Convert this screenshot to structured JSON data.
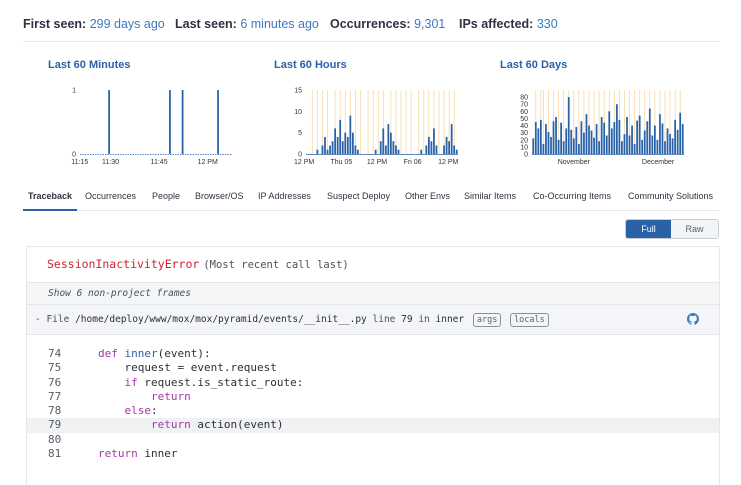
{
  "stats": {
    "first_seen_label": "First seen:",
    "first_seen_value": "299 days ago",
    "last_seen_label": "Last seen:",
    "last_seen_value": "6 minutes ago",
    "occurrences_label": "Occurrences:",
    "occurrences_value": "9,301",
    "ips_label": "IPs affected:",
    "ips_value": "330"
  },
  "colors": {
    "accent": "#2a62a8",
    "link": "#3a7bbf",
    "error": "#d0222c",
    "bar": "#2a62a8",
    "deploy_marker": "#f5d9a4"
  },
  "chart_data": [
    {
      "type": "bar",
      "title": "Last 60 Minutes",
      "yticks": [
        "1",
        "0"
      ],
      "ylim": [
        0,
        1
      ],
      "xticks": [
        "11:15",
        "11:30",
        "11:45",
        "12 PM"
      ],
      "values": [
        0,
        0,
        0,
        0,
        0,
        0,
        0,
        0,
        0,
        0,
        0,
        1,
        0,
        0,
        0,
        0,
        0,
        0,
        0,
        0,
        0,
        0,
        0,
        0,
        0,
        0,
        0,
        0,
        0,
        0,
        0,
        0,
        0,
        0,
        0,
        1,
        0,
        0,
        0,
        0,
        1,
        0,
        0,
        0,
        0,
        0,
        0,
        0,
        0,
        0,
        0,
        0,
        0,
        0,
        1,
        0,
        0,
        0,
        0,
        0
      ]
    },
    {
      "type": "bar",
      "title": "Last 60 Hours",
      "yticks": [
        "15",
        "10",
        "5",
        "0"
      ],
      "ylim": [
        0,
        15
      ],
      "xticks": [
        "12 PM",
        "Thu 05",
        "12 PM",
        "Fri 06",
        "12 PM"
      ],
      "values": [
        0,
        0,
        0,
        0,
        1,
        0,
        2,
        4,
        1,
        2,
        3,
        6,
        4,
        8,
        3,
        5,
        4,
        9,
        5,
        2,
        1,
        0,
        0,
        0,
        0,
        0,
        0,
        1,
        0,
        3,
        6,
        2,
        7,
        5,
        3,
        2,
        1,
        0,
        0,
        0,
        0,
        0,
        0,
        0,
        0,
        1,
        0,
        2,
        4,
        3,
        6,
        2,
        0,
        0,
        2,
        4,
        3,
        7,
        2,
        1
      ],
      "deploys": [
        2,
        4,
        6,
        8,
        11,
        13,
        15,
        17,
        19,
        21,
        24,
        26,
        28,
        30,
        33,
        35,
        37,
        39,
        41,
        44,
        46,
        48,
        50,
        52,
        54,
        56,
        58
      ]
    },
    {
      "type": "bar",
      "title": "Last 60 Days",
      "yticks": [
        "80",
        "70",
        "60",
        "50",
        "40",
        "30",
        "20",
        "10",
        "0"
      ],
      "ylim": [
        0,
        90
      ],
      "xticks": [
        "November",
        "December"
      ],
      "values": [
        22,
        45,
        36,
        48,
        14,
        42,
        31,
        24,
        46,
        52,
        20,
        44,
        18,
        36,
        80,
        34,
        22,
        38,
        14,
        46,
        30,
        56,
        40,
        33,
        23,
        42,
        18,
        52,
        44,
        26,
        60,
        36,
        45,
        70,
        48,
        18,
        28,
        52,
        26,
        40,
        14,
        47,
        54,
        20,
        33,
        46,
        64,
        26,
        40,
        20,
        56,
        43,
        18,
        36,
        28,
        22,
        48,
        34,
        58,
        42
      ],
      "deploys": [
        1,
        3,
        4,
        6,
        8,
        10,
        12,
        14,
        16,
        18,
        20,
        22,
        24,
        26,
        28,
        30,
        32,
        34,
        36,
        38,
        40,
        42,
        44,
        46,
        48,
        50,
        52,
        54,
        56,
        58
      ]
    }
  ],
  "tabs": [
    {
      "label": "Traceback"
    },
    {
      "label": "Occurrences"
    },
    {
      "label": "People"
    },
    {
      "label": "Browser/OS"
    },
    {
      "label": "IP Addresses"
    },
    {
      "label": "Suspect Deploy"
    },
    {
      "label": "Other Envs"
    },
    {
      "label": "Similar Items"
    },
    {
      "label": "Co-Occurring Items"
    },
    {
      "label": "Community Solutions"
    }
  ],
  "toggle": {
    "full": "Full",
    "raw": "Raw",
    "selected": "Full"
  },
  "trace": {
    "error_name": "SessionInactivityError",
    "error_tail": "(Most recent call last)",
    "frames_toggle": "Show 6 non-project frames",
    "file_prefix": "- File",
    "file_path": "/home/deploy/www/mox/mox/pyramid/events/__init__.py",
    "line_word": "line",
    "line_number": "79",
    "in_word": "in",
    "function": "inner",
    "args_label": "args",
    "locals_label": "locals",
    "github_icon": "github-icon"
  },
  "code": [
    {
      "n": "74",
      "indent": "",
      "parts": [
        {
          "t": "def",
          "c": "kw"
        },
        {
          "t": " "
        },
        {
          "t": "inner",
          "c": "fn"
        },
        {
          "t": "(event):"
        }
      ]
    },
    {
      "n": "75",
      "indent": "    ",
      "parts": [
        {
          "t": "request = event.request"
        }
      ]
    },
    {
      "n": "76",
      "indent": "    ",
      "parts": [
        {
          "t": "if",
          "c": "kw"
        },
        {
          "t": " request.is_static_route:"
        }
      ]
    },
    {
      "n": "77",
      "indent": "        ",
      "parts": [
        {
          "t": "return",
          "c": "kw"
        }
      ]
    },
    {
      "n": "78",
      "indent": "    ",
      "parts": [
        {
          "t": "else",
          "c": "kw"
        },
        {
          "t": ":"
        }
      ]
    },
    {
      "n": "79",
      "indent": "        ",
      "parts": [
        {
          "t": "return",
          "c": "kw"
        },
        {
          "t": " action(event)"
        }
      ],
      "highlight": true
    },
    {
      "n": "80",
      "indent": "",
      "parts": []
    },
    {
      "n": "81",
      "indent": "",
      "parts": [
        {
          "t": "return",
          "c": "kw"
        },
        {
          "t": " inner"
        }
      ]
    }
  ]
}
